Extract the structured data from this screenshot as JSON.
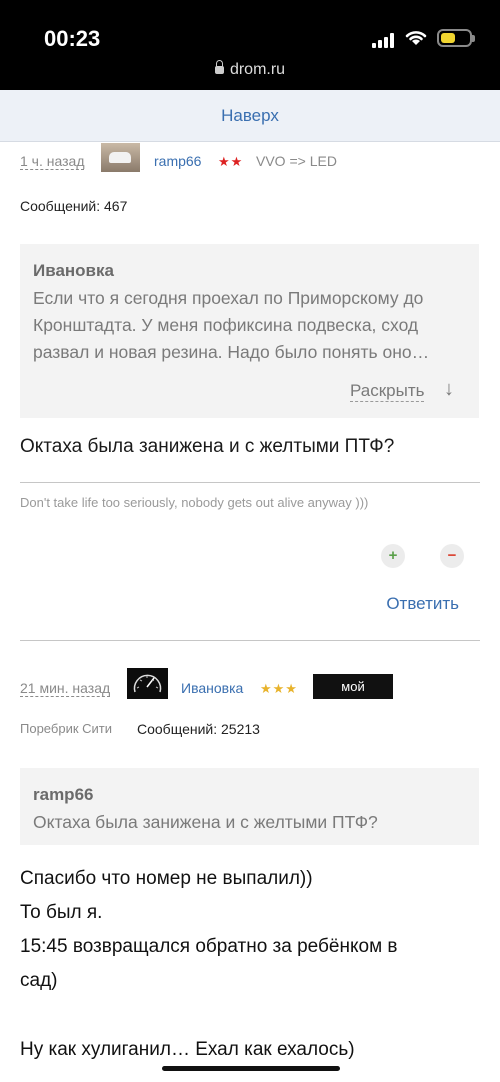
{
  "status": {
    "time": "00:23",
    "url": "drom.ru"
  },
  "nav": {
    "top_label": "Наверх"
  },
  "post1": {
    "ago": "1 ч. назад",
    "username": "ramp66",
    "stars": "★★",
    "car": "VVO => LED",
    "messages": "Сообщений: 467",
    "quote_author": "Ивановка",
    "quote_lines": [
      "Если что я сегодня проехал по Приморскому до",
      "Кронштадта. У меня пофиксина подвеска, сход",
      "развал и новая резина. Надо было понять оно…"
    ],
    "expand_label": "Раскрыть",
    "expand_arrow": "↓",
    "text": "Октаха была занижена и с желтыми ПТФ?",
    "signature": "Don't take life too seriously, nobody gets out alive anyway )))",
    "plus": "+",
    "minus": "−",
    "reply_label": "Ответить"
  },
  "post2": {
    "ago": "21 мин. назад",
    "username": "Ивановка",
    "stars": "★★★",
    "badge": "мой",
    "city": "Поребрик Сити",
    "messages": "Сообщений: 25213",
    "quote_author": "ramp66",
    "quote_text": "Октаха была занижена и с желтыми ПТФ?",
    "lines": [
      "Спасибо что номер не выпалил))",
      "То был я.",
      "15:45 возвращался обратно за ребёнком в",
      "сад)",
      "",
      "Ну как хулиганил… Ехал как ехалось)"
    ]
  },
  "colors": {
    "link": "#3a6fb0",
    "plus": "#5aa04a",
    "minus": "#d9402e",
    "star_red": "#d22222",
    "star_gold": "#e8b32c"
  }
}
